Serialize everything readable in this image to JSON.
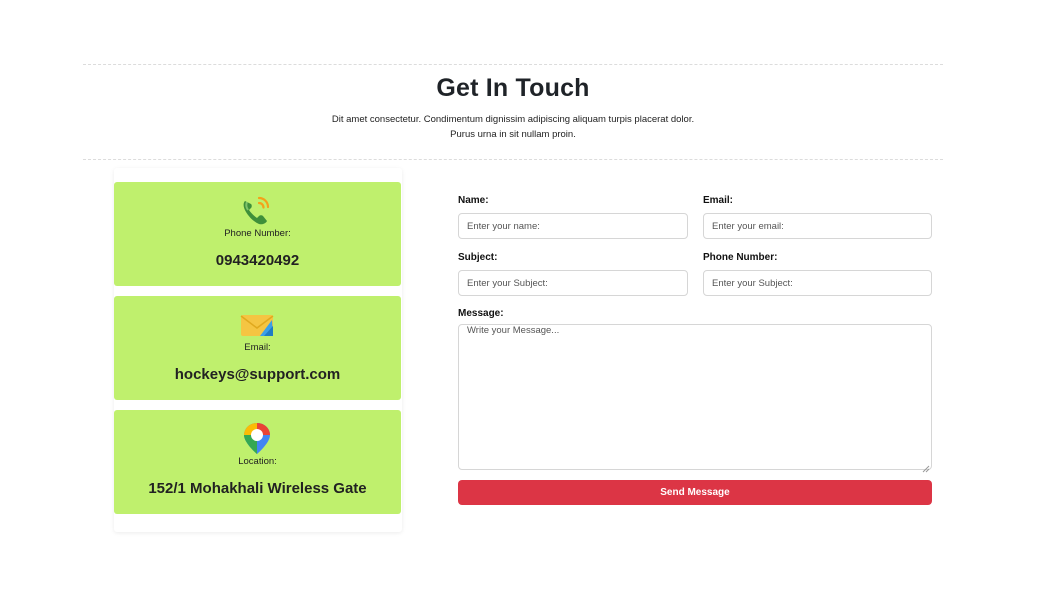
{
  "header": {
    "title": "Get In Touch",
    "subtitle_line1": "Dit amet consectetur. Condimentum dignissim adipiscing aliquam turpis placerat dolor.",
    "subtitle_line2": "Purus urna in sit nullam proin."
  },
  "contact_cards": {
    "phone": {
      "label": "Phone Number:",
      "value": "0943420492",
      "icon": "phone-icon"
    },
    "email": {
      "label": "Email:",
      "value": "hockeys@support.com",
      "icon": "envelope-icon"
    },
    "location": {
      "label": "Location:",
      "value": "152/1 Mohakhali Wireless Gate",
      "icon": "map-pin-icon"
    }
  },
  "form": {
    "name": {
      "label": "Name:",
      "placeholder": "Enter your name:",
      "value": ""
    },
    "email": {
      "label": "Email:",
      "placeholder": "Enter your email:",
      "value": ""
    },
    "subject": {
      "label": "Subject:",
      "placeholder": "Enter your Subject:",
      "value": ""
    },
    "phone": {
      "label": "Phone Number:",
      "placeholder": "Enter your Subject:",
      "value": ""
    },
    "message": {
      "label": "Message:",
      "placeholder": "Write your Message...",
      "value": ""
    },
    "submit_label": "Send Message"
  },
  "colors": {
    "card_bg": "#bff06d",
    "button_bg": "#dc3545",
    "button_text": "#ffffff"
  }
}
